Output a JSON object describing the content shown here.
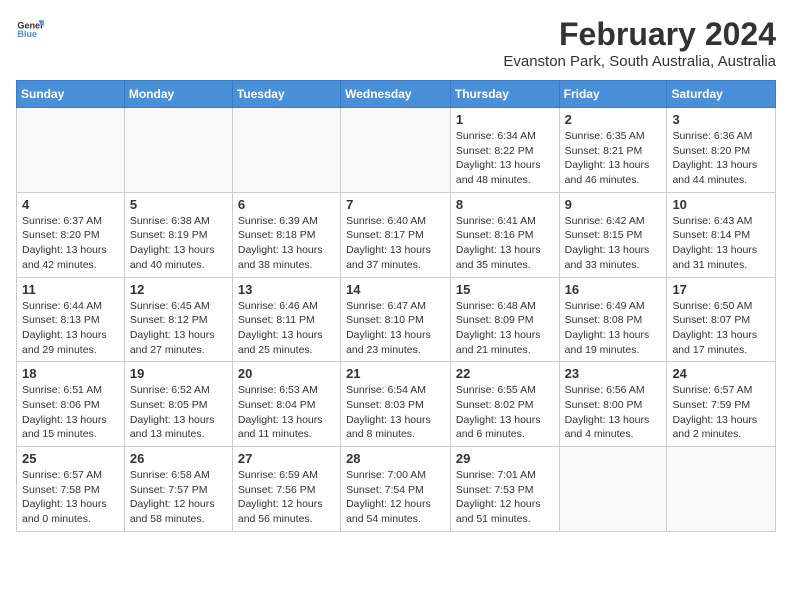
{
  "logo": {
    "text_general": "General",
    "text_blue": "Blue"
  },
  "title": "February 2024",
  "subtitle": "Evanston Park, South Australia, Australia",
  "days_of_week": [
    "Sunday",
    "Monday",
    "Tuesday",
    "Wednesday",
    "Thursday",
    "Friday",
    "Saturday"
  ],
  "weeks": [
    [
      {
        "day": "",
        "detail": ""
      },
      {
        "day": "",
        "detail": ""
      },
      {
        "day": "",
        "detail": ""
      },
      {
        "day": "",
        "detail": ""
      },
      {
        "day": "1",
        "detail": "Sunrise: 6:34 AM\nSunset: 8:22 PM\nDaylight: 13 hours\nand 48 minutes."
      },
      {
        "day": "2",
        "detail": "Sunrise: 6:35 AM\nSunset: 8:21 PM\nDaylight: 13 hours\nand 46 minutes."
      },
      {
        "day": "3",
        "detail": "Sunrise: 6:36 AM\nSunset: 8:20 PM\nDaylight: 13 hours\nand 44 minutes."
      }
    ],
    [
      {
        "day": "4",
        "detail": "Sunrise: 6:37 AM\nSunset: 8:20 PM\nDaylight: 13 hours\nand 42 minutes."
      },
      {
        "day": "5",
        "detail": "Sunrise: 6:38 AM\nSunset: 8:19 PM\nDaylight: 13 hours\nand 40 minutes."
      },
      {
        "day": "6",
        "detail": "Sunrise: 6:39 AM\nSunset: 8:18 PM\nDaylight: 13 hours\nand 38 minutes."
      },
      {
        "day": "7",
        "detail": "Sunrise: 6:40 AM\nSunset: 8:17 PM\nDaylight: 13 hours\nand 37 minutes."
      },
      {
        "day": "8",
        "detail": "Sunrise: 6:41 AM\nSunset: 8:16 PM\nDaylight: 13 hours\nand 35 minutes."
      },
      {
        "day": "9",
        "detail": "Sunrise: 6:42 AM\nSunset: 8:15 PM\nDaylight: 13 hours\nand 33 minutes."
      },
      {
        "day": "10",
        "detail": "Sunrise: 6:43 AM\nSunset: 8:14 PM\nDaylight: 13 hours\nand 31 minutes."
      }
    ],
    [
      {
        "day": "11",
        "detail": "Sunrise: 6:44 AM\nSunset: 8:13 PM\nDaylight: 13 hours\nand 29 minutes."
      },
      {
        "day": "12",
        "detail": "Sunrise: 6:45 AM\nSunset: 8:12 PM\nDaylight: 13 hours\nand 27 minutes."
      },
      {
        "day": "13",
        "detail": "Sunrise: 6:46 AM\nSunset: 8:11 PM\nDaylight: 13 hours\nand 25 minutes."
      },
      {
        "day": "14",
        "detail": "Sunrise: 6:47 AM\nSunset: 8:10 PM\nDaylight: 13 hours\nand 23 minutes."
      },
      {
        "day": "15",
        "detail": "Sunrise: 6:48 AM\nSunset: 8:09 PM\nDaylight: 13 hours\nand 21 minutes."
      },
      {
        "day": "16",
        "detail": "Sunrise: 6:49 AM\nSunset: 8:08 PM\nDaylight: 13 hours\nand 19 minutes."
      },
      {
        "day": "17",
        "detail": "Sunrise: 6:50 AM\nSunset: 8:07 PM\nDaylight: 13 hours\nand 17 minutes."
      }
    ],
    [
      {
        "day": "18",
        "detail": "Sunrise: 6:51 AM\nSunset: 8:06 PM\nDaylight: 13 hours\nand 15 minutes."
      },
      {
        "day": "19",
        "detail": "Sunrise: 6:52 AM\nSunset: 8:05 PM\nDaylight: 13 hours\nand 13 minutes."
      },
      {
        "day": "20",
        "detail": "Sunrise: 6:53 AM\nSunset: 8:04 PM\nDaylight: 13 hours\nand 11 minutes."
      },
      {
        "day": "21",
        "detail": "Sunrise: 6:54 AM\nSunset: 8:03 PM\nDaylight: 13 hours\nand 8 minutes."
      },
      {
        "day": "22",
        "detail": "Sunrise: 6:55 AM\nSunset: 8:02 PM\nDaylight: 13 hours\nand 6 minutes."
      },
      {
        "day": "23",
        "detail": "Sunrise: 6:56 AM\nSunset: 8:00 PM\nDaylight: 13 hours\nand 4 minutes."
      },
      {
        "day": "24",
        "detail": "Sunrise: 6:57 AM\nSunset: 7:59 PM\nDaylight: 13 hours\nand 2 minutes."
      }
    ],
    [
      {
        "day": "25",
        "detail": "Sunrise: 6:57 AM\nSunset: 7:58 PM\nDaylight: 13 hours\nand 0 minutes."
      },
      {
        "day": "26",
        "detail": "Sunrise: 6:58 AM\nSunset: 7:57 PM\nDaylight: 12 hours\nand 58 minutes."
      },
      {
        "day": "27",
        "detail": "Sunrise: 6:59 AM\nSunset: 7:56 PM\nDaylight: 12 hours\nand 56 minutes."
      },
      {
        "day": "28",
        "detail": "Sunrise: 7:00 AM\nSunset: 7:54 PM\nDaylight: 12 hours\nand 54 minutes."
      },
      {
        "day": "29",
        "detail": "Sunrise: 7:01 AM\nSunset: 7:53 PM\nDaylight: 12 hours\nand 51 minutes."
      },
      {
        "day": "",
        "detail": ""
      },
      {
        "day": "",
        "detail": ""
      }
    ]
  ]
}
